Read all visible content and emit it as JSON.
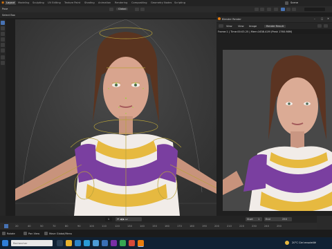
{
  "menubar": {
    "tabs": [
      {
        "label": "Layout"
      },
      {
        "label": "Modeling"
      },
      {
        "label": "Sculpting"
      },
      {
        "label": "UV Editing"
      },
      {
        "label": "Texture Paint"
      },
      {
        "label": "Shading"
      },
      {
        "label": "Animation"
      },
      {
        "label": "Rendering"
      },
      {
        "label": "Compositing"
      },
      {
        "label": "Geometry Nodes"
      },
      {
        "label": "Scripting"
      }
    ],
    "scene_label": "Scene"
  },
  "header": {
    "mode": "Pose",
    "orientation_label": "Global",
    "select_box": "Select Box"
  },
  "render_window": {
    "title": "Blender Render",
    "menu": [
      "View",
      "View",
      "Image"
    ],
    "slot_label": "Render Result",
    "info": "Frame:1 | Time:00:03.25 | Mem:1638.41M (Peak 1760.98M)"
  },
  "timeline": {
    "frame_numbers": [
      "20",
      "40",
      "50",
      "70",
      "80",
      "90",
      "100",
      "110",
      "120",
      "130",
      "140",
      "150",
      "160",
      "170",
      "180",
      "190",
      "200",
      "210",
      "220",
      "230",
      "240",
      "250"
    ],
    "current_frame": "1",
    "start_label": "Start",
    "start_value": "1",
    "end_label": "End",
    "end_value": "250"
  },
  "status": {
    "left": "Rotate",
    "middle": "Pan View",
    "right": "Move Global/Menu"
  },
  "taskbar": {
    "weather": "20°C  Ciel ensoleillé",
    "search_placeholder": "Rechercher"
  },
  "colors": {
    "accent": "#4772b3",
    "armature": "#b7a23a",
    "outfit_purple": "#7a3fa0",
    "outfit_yellow": "#e6b940"
  }
}
